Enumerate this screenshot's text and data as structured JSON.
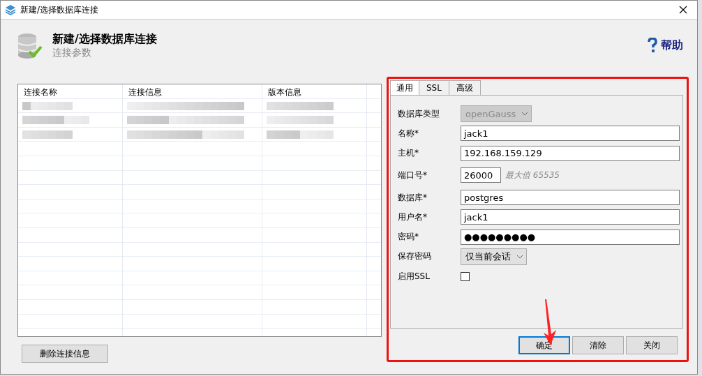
{
  "window": {
    "title": "新建/选择数据库连接"
  },
  "header": {
    "title": "新建/选择数据库连接",
    "subtitle": "连接参数",
    "help": "帮助"
  },
  "table": {
    "columns": [
      "连接名称",
      "连接信息",
      "版本信息"
    ],
    "rows": [
      {
        "kind": "blurred"
      },
      {
        "kind": "blurred"
      },
      {
        "kind": "blurred"
      }
    ]
  },
  "delete_button": "删除连接信息",
  "tabs": [
    {
      "label": "通用",
      "selected": true
    },
    {
      "label": "SSL",
      "selected": false
    },
    {
      "label": "高级",
      "selected": false
    }
  ],
  "fields": [
    {
      "kind": "select",
      "label": "数据库类型",
      "value": "openGauss",
      "disabled": true
    },
    {
      "kind": "text",
      "label": "名称*",
      "value": "jack1"
    },
    {
      "kind": "text",
      "label": "主机*",
      "value": "192.168.159.129"
    },
    {
      "kind": "port",
      "label": "端口号*",
      "value": "26000",
      "hint": "最大值 65535"
    },
    {
      "kind": "text",
      "label": "数据库*",
      "value": "postgres"
    },
    {
      "kind": "text",
      "label": "用户名*",
      "value": "jack1"
    },
    {
      "kind": "text",
      "label": "密码*",
      "value": "●●●●●●●●●"
    },
    {
      "kind": "select",
      "label": "保存密码",
      "value": "仅当前会话",
      "disabled": false
    },
    {
      "kind": "checkbox",
      "label": "启用SSL",
      "checked": false
    }
  ],
  "buttons": [
    {
      "label": "确定",
      "default": true
    },
    {
      "label": "清除",
      "default": false
    },
    {
      "label": "关闭",
      "default": false
    }
  ]
}
